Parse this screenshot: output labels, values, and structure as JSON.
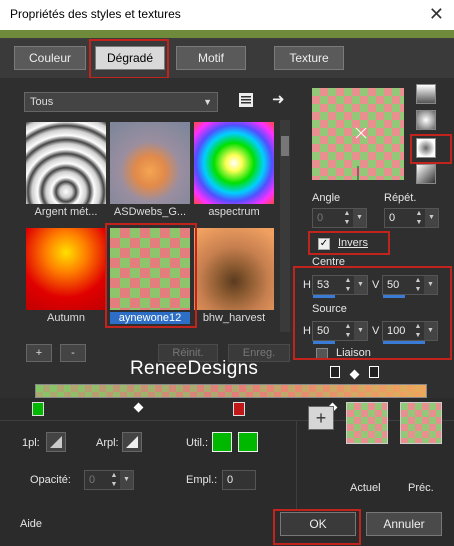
{
  "window": {
    "title": "Propriétés des styles et textures",
    "close_glyph": "✕"
  },
  "tabs": [
    {
      "label": "Couleur",
      "active": false
    },
    {
      "label": "Dégradé",
      "active": true
    },
    {
      "label": "Motif",
      "active": false
    },
    {
      "label": "Texture",
      "active": false
    }
  ],
  "library": {
    "dropdown_value": "Tous",
    "thumbnails": [
      {
        "label": "Argent mét..."
      },
      {
        "label": "ASDwebs_G..."
      },
      {
        "label": "aspectrum"
      },
      {
        "label": "Autumn"
      },
      {
        "label": "aynewone12",
        "selected": true
      },
      {
        "label": "bhw_harvest"
      }
    ],
    "add_label": "+",
    "remove_label": "-",
    "reset_label": "Réinit.",
    "save_label": "Enreg."
  },
  "settings": {
    "angle_label": "Angle",
    "angle_value": "0",
    "repeat_label": "Répét.",
    "repeat_value": "0",
    "invert_label": "Invers",
    "invert_checked": true,
    "center_label": "Centre",
    "center_h_label": "H",
    "center_h_value": "53",
    "center_v_label": "V",
    "center_v_value": "50",
    "source_label": "Source",
    "source_h_label": "H",
    "source_h_value": "50",
    "source_v_label": "V",
    "source_v_value": "100",
    "link_label": "Liaison"
  },
  "watermark": "ReneeDesigns",
  "bottom": {
    "first_label": "1pl:",
    "arrow_label": "Arpl:",
    "use_label": "Util.:",
    "opacity_label": "Opacité:",
    "opacity_value": "0",
    "location_label": "Empl.:",
    "location_value": "0",
    "add_label": "+",
    "current_label": "Actuel",
    "previous_label": "Préc."
  },
  "footer": {
    "help_label": "Aide",
    "ok_label": "OK",
    "cancel_label": "Annuler"
  },
  "colors": {
    "highlight_red": "#c0241c",
    "selection_blue": "#2d6fc6",
    "swatch_green": "#00b800"
  }
}
